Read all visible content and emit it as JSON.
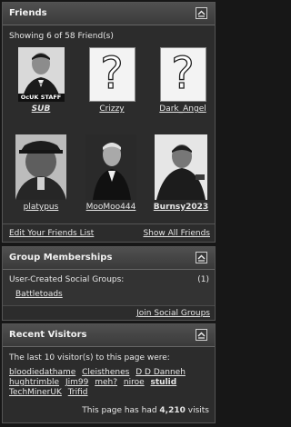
{
  "friends": {
    "title": "Friends",
    "count_text": "Showing 6 of 58 Friend(s)",
    "items": [
      {
        "name": "SUB",
        "tag": "OcUK STAFF",
        "photo": "man-in-suit-bw"
      },
      {
        "name": "Crizzy",
        "photo": "question-mark"
      },
      {
        "name": "Dark_Angel",
        "photo": "question-mark"
      },
      {
        "name": "platypus",
        "photo": "man-with-hat-bw"
      },
      {
        "name": "MooMoo444",
        "photo": "man-in-suit-bw"
      },
      {
        "name": "Burnsy2023",
        "photo": "man-in-jacket-bw"
      }
    ],
    "edit_link": "Edit Your Friends List",
    "show_all_link": "Show All Friends"
  },
  "groups": {
    "title": "Group Memberships",
    "label": "User-Created Social Groups:",
    "count": "(1)",
    "items": [
      "Battletoads"
    ],
    "join_link": "Join Social Groups"
  },
  "visitors": {
    "title": "Recent Visitors",
    "intro": "The last 10 visitor(s) to this page were:",
    "names": [
      "bloodiedathame",
      "Cleisthenes",
      "D D Danneh",
      "hughtrimble",
      "Jim99",
      "meh?",
      "niroe",
      "stulid",
      "TechMinerUK",
      "Trifid"
    ],
    "total_prefix": "This page has had",
    "total_count": "4,210",
    "total_suffix": "visits"
  },
  "icons": {
    "collapse": "collapse-icon"
  },
  "colors": {
    "background": "#171717",
    "panel": "#2c2c2c",
    "header": "#454545",
    "text": "#e6e6e6"
  }
}
